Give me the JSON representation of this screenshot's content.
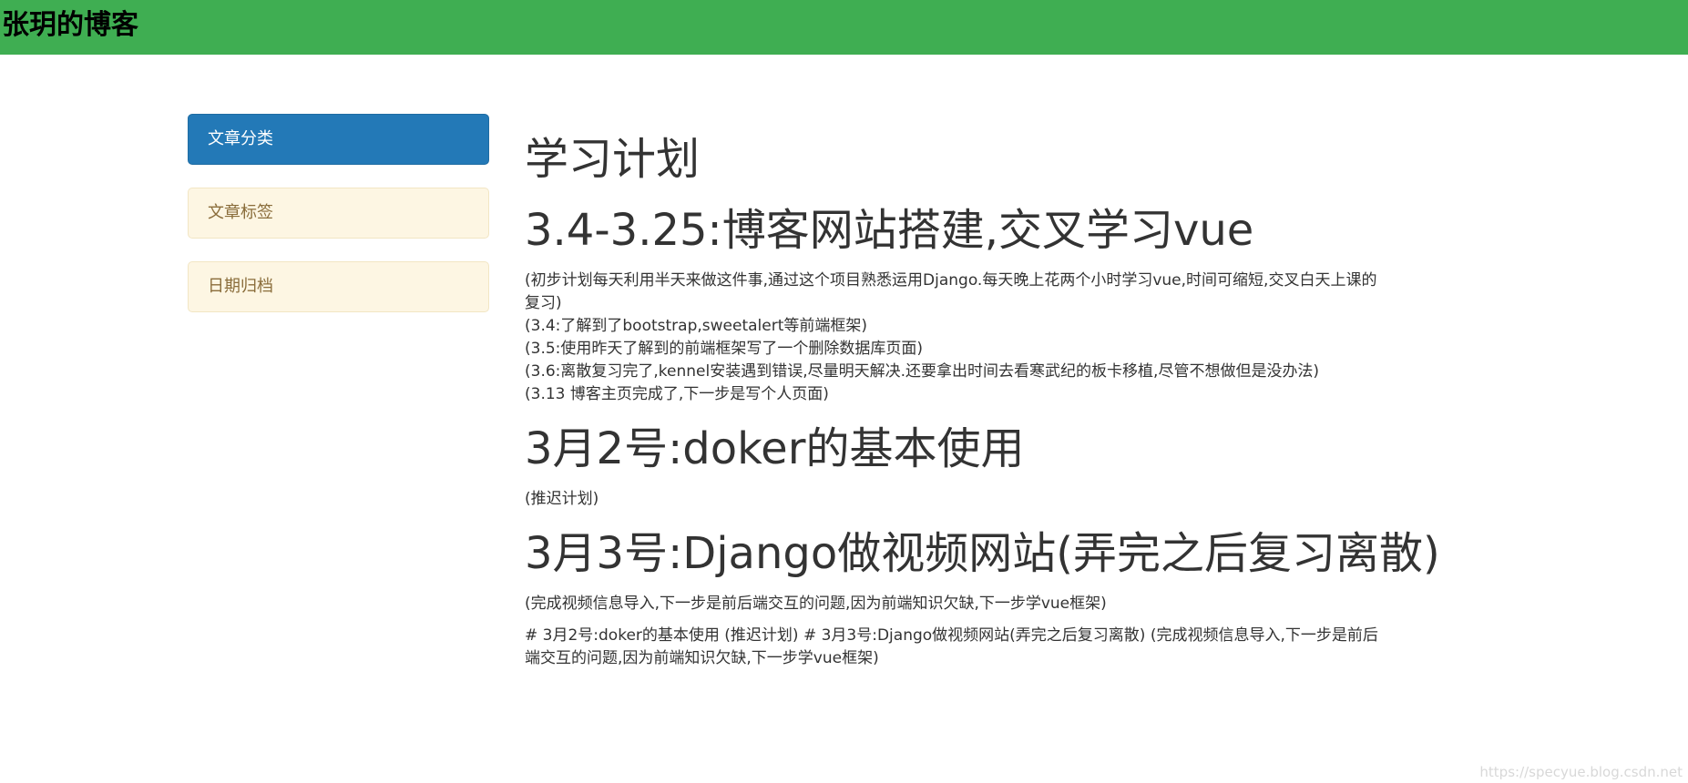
{
  "header": {
    "brand": "张玥的博客"
  },
  "sidebar": {
    "items": [
      {
        "label": "文章分类"
      },
      {
        "label": "文章标签"
      },
      {
        "label": "日期归档"
      }
    ]
  },
  "article": {
    "title": "学习计划",
    "section1": {
      "heading": "3.4-3.25:博客网站搭建,交叉学习vue",
      "lines": [
        "(初步计划每天利用半天来做这件事,通过这个项目熟悉运用Django.每天晚上花两个小时学习vue,时间可缩短,交叉白天上课的复习)",
        "(3.4:了解到了bootstrap,sweetalert等前端框架)",
        "(3.5:使用昨天了解到的前端框架写了一个删除数据库页面)",
        "(3.6:离散复习完了,kennel安装遇到错误,尽量明天解决.还要拿出时间去看寒武纪的板卡移植,尽管不想做但是没办法)",
        "(3.13 博客主页完成了,下一步是写个人页面)"
      ]
    },
    "section2": {
      "heading": "3月2号:doker的基本使用",
      "text": "(推迟计划)"
    },
    "section3": {
      "heading": "3月3号:Django做视频网站(弄完之后复习离散)",
      "text": "(完成视频信息导入,下一步是前后端交互的问题,因为前端知识欠缺,下一步学vue框架)"
    },
    "raw_text": "# 3月2号:doker的基本使用 (推迟计划) # 3月3号:Django做视频网站(弄完之后复习离散) (完成视频信息导入,下一步是前后端交互的问题,因为前端知识欠缺,下一步学vue框架)"
  },
  "watermark": "https://specyue.blog.csdn.net",
  "colors": {
    "header_bg": "#3fae52",
    "primary_panel": "#2379b7",
    "warning_panel": "#fdf6e3",
    "warning_text": "#8a6d3b"
  }
}
